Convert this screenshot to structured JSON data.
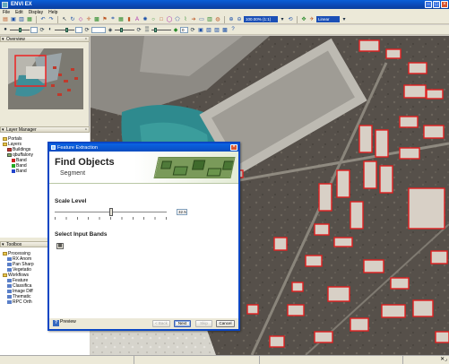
{
  "window": {
    "title": "ENVI EX"
  },
  "menu": [
    "File",
    "Edit",
    "Display",
    "Help"
  ],
  "toolbar": {
    "zoom_value": "100.00% (1:1)",
    "stretch_value": "Linear",
    "opacity_value": "0"
  },
  "panels": {
    "overview": "Overview",
    "layer_manager": "Layer Manager",
    "toolbox": "Toolbox"
  },
  "layers": [
    {
      "label": "Portals",
      "indent": 1,
      "kind": "folder"
    },
    {
      "label": "Layers",
      "indent": 1,
      "kind": "folder"
    },
    {
      "label": "Buildings",
      "indent": 2,
      "kind": "vector",
      "color": "#c0392b"
    },
    {
      "label": "qbuffalony",
      "indent": 2,
      "kind": "raster"
    },
    {
      "label": "Band",
      "indent": 3,
      "kind": "band",
      "color": "#cc2222"
    },
    {
      "label": "Band",
      "indent": 3,
      "kind": "band",
      "color": "#22aa22"
    },
    {
      "label": "Band",
      "indent": 3,
      "kind": "band",
      "color": "#2244cc"
    }
  ],
  "toolbox_items": [
    {
      "label": "Processing",
      "indent": 1,
      "kind": "folder"
    },
    {
      "label": "RX Anom",
      "indent": 2,
      "kind": "tool"
    },
    {
      "label": "Pan Sharp",
      "indent": 2,
      "kind": "tool"
    },
    {
      "label": "Vegetatio",
      "indent": 2,
      "kind": "tool"
    },
    {
      "label": "Workflows",
      "indent": 1,
      "kind": "folder"
    },
    {
      "label": "Feature",
      "indent": 2,
      "kind": "tool"
    },
    {
      "label": "Classifica",
      "indent": 2,
      "kind": "tool"
    },
    {
      "label": "Image Diff",
      "indent": 2,
      "kind": "tool"
    },
    {
      "label": "Thematic",
      "indent": 2,
      "kind": "tool"
    },
    {
      "label": "RPC Orth",
      "indent": 2,
      "kind": "tool"
    }
  ],
  "dialog": {
    "title": "Feature Extraction",
    "heading": "Find Objects",
    "subheading": "Segment",
    "scale_label": "Scale Level",
    "scale_value": "32.5",
    "scale_fraction": 0.5,
    "bands_label": "Select Input Bands",
    "preview_label": "Preview",
    "buttons": {
      "back": "< Back",
      "next": "Next",
      "skip": "Skip",
      "cancel": "Cancel"
    }
  },
  "colors": {
    "titlebar": "#0b48b5",
    "building_outline": "#e02020",
    "water": "#2e8a8e",
    "ground": "#5a5348"
  },
  "icons": [
    "app-icon",
    "minimize-icon",
    "maximize-icon",
    "close-icon",
    "pin-icon",
    "help-icon"
  ]
}
